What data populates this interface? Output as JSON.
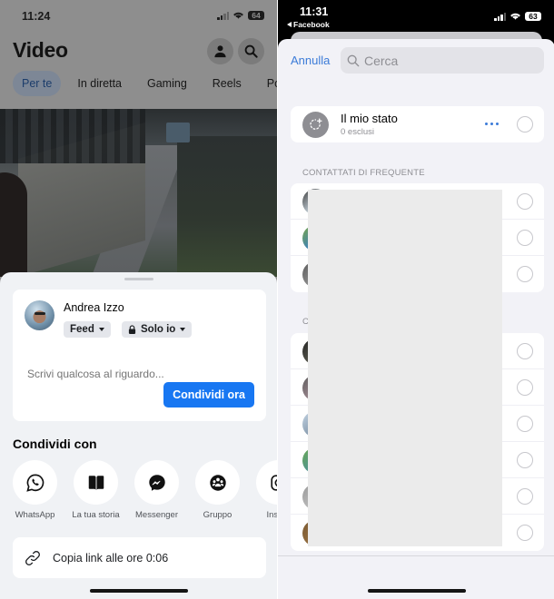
{
  "left": {
    "status_bar": {
      "time": "11:24",
      "battery": "64"
    },
    "header": {
      "title": "Video",
      "profile_icon": "person-icon",
      "search_icon": "search-icon"
    },
    "tabs": [
      {
        "label": "Per te",
        "active": true
      },
      {
        "label": "In diretta",
        "active": false
      },
      {
        "label": "Gaming",
        "active": false
      },
      {
        "label": "Reels",
        "active": false
      },
      {
        "label": "Popolari",
        "active": false
      }
    ],
    "tab_overflow_label": "Pop",
    "share_sheet": {
      "composer": {
        "user_name": "Andrea Izzo",
        "destination_chip": "Feed",
        "privacy_chip": "Solo io",
        "placeholder": "Scrivi qualcosa al riguardo...",
        "share_button": "Condividi ora"
      },
      "share_with_title": "Condividi con",
      "apps": [
        {
          "label": "WhatsApp",
          "icon": "whatsapp-icon"
        },
        {
          "label": "La tua storia",
          "icon": "story-book-icon"
        },
        {
          "label": "Messenger",
          "icon": "messenger-icon"
        },
        {
          "label": "Gruppo",
          "icon": "group-icon"
        },
        {
          "label": "Instagram",
          "icon": "instagram-icon"
        }
      ],
      "app_overflow_label": "Instag",
      "copy_link_label": "Copia link alle ore 0:06"
    }
  },
  "right": {
    "status_bar": {
      "time": "11:31",
      "back_app": "Facebook",
      "battery": "63"
    },
    "cancel_label": "Annulla",
    "search_placeholder": "Cerca",
    "my_status": {
      "title": "Il mio stato",
      "subtitle": "0 esclusi"
    },
    "frequent_section_label": "CONTATTATI DI FREQUENTE",
    "second_section_label": "C",
    "frequent_contacts_count": 3,
    "other_contacts_count": 6
  },
  "colors": {
    "facebook_blue": "#1877f2",
    "ios_link_blue": "#3b7bd8",
    "sheet_bg": "#f0f2f5",
    "ios_grouped_bg": "#f2f2f7"
  }
}
